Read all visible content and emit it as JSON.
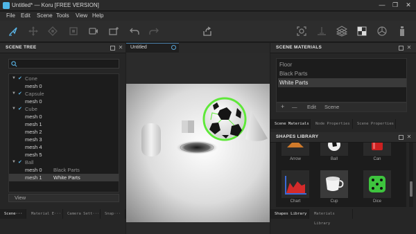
{
  "window": {
    "title": "Untitled* — Koru [FREE VERSION]",
    "minimize": "—",
    "restore": "❐",
    "close": "✕"
  },
  "menu": [
    "File",
    "Edit",
    "Scene",
    "Tools",
    "View",
    "Help"
  ],
  "toolbar": {
    "icons": [
      "select-arrow-icon",
      "move-icon",
      "rotate-icon",
      "scale-icon",
      "camera-icon",
      "add-camera-icon",
      "undo-icon",
      "redo-icon",
      "share-icon",
      "focus-icon",
      "ground-icon",
      "grid-layout-icon",
      "checker-icon",
      "sphere-render-icon",
      "bottle-icon"
    ]
  },
  "scene_tree": {
    "title": "SCENE TREE",
    "search_placeholder": "",
    "items": [
      {
        "label": "Cone",
        "parent": true
      },
      {
        "label": "mesh 0",
        "parent": false,
        "material": ""
      },
      {
        "label": "Capsule",
        "parent": true
      },
      {
        "label": "mesh 0",
        "parent": false,
        "material": ""
      },
      {
        "label": "Cube",
        "parent": true
      },
      {
        "label": "mesh 0",
        "parent": false,
        "material": ""
      },
      {
        "label": "mesh 1",
        "parent": false,
        "material": ""
      },
      {
        "label": "mesh 2",
        "parent": false,
        "material": ""
      },
      {
        "label": "mesh 3",
        "parent": false,
        "material": ""
      },
      {
        "label": "mesh 4",
        "parent": false,
        "material": ""
      },
      {
        "label": "mesh 5",
        "parent": false,
        "material": ""
      },
      {
        "label": "Ball",
        "parent": true
      },
      {
        "label": "mesh 0",
        "parent": false,
        "material": "Black Parts"
      },
      {
        "label": "mesh 1",
        "parent": false,
        "material": "White Parts",
        "selected": true
      }
    ],
    "view_button": "View",
    "tabs": [
      "Scene···",
      "Material E···",
      "Camera Sett···",
      "Snap···"
    ]
  },
  "viewport": {
    "tab": "Untitled"
  },
  "scene_materials": {
    "title": "SCENE MATERIALS",
    "items": [
      "Floor",
      "Black Parts",
      "White Parts"
    ],
    "selected_index": 2,
    "actions": {
      "add": "+",
      "remove": "—",
      "edit": "Edit",
      "scene": "Scene"
    },
    "tabs": [
      "Scene Materials",
      "Node Properties",
      "Scene Properties"
    ]
  },
  "shapes_library": {
    "title": "SHAPES LIBRARY",
    "items": [
      {
        "label": "Arrow"
      },
      {
        "label": "Ball"
      },
      {
        "label": "Can"
      },
      {
        "label": "Chart"
      },
      {
        "label": "Cup"
      },
      {
        "label": "Dice"
      }
    ],
    "tabs": [
      "Shapes Library",
      "Materials Library"
    ]
  },
  "colors": {
    "accent": "#5ab4e6",
    "selection_outline": "#5fe83a",
    "dice": "#3ec43e",
    "chart_red": "#d42a2a",
    "can_red": "#cc2020"
  }
}
